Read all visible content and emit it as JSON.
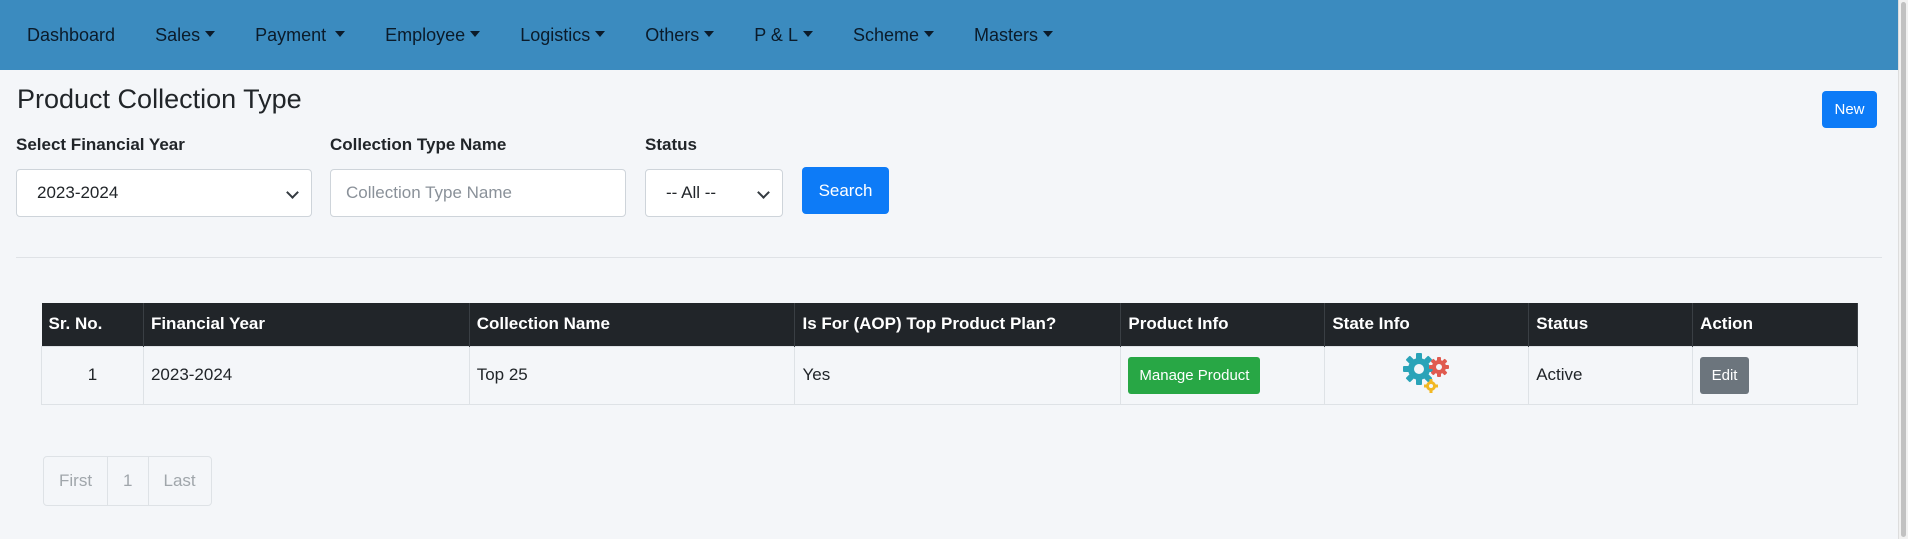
{
  "nav": {
    "items": [
      {
        "label": "Dashboard",
        "dropdown": false
      },
      {
        "label": "Sales",
        "dropdown": true
      },
      {
        "label": "Payment",
        "dropdown": true
      },
      {
        "label": "Employee",
        "dropdown": true
      },
      {
        "label": "Logistics",
        "dropdown": true
      },
      {
        "label": "Others",
        "dropdown": true
      },
      {
        "label": "P & L",
        "dropdown": true
      },
      {
        "label": "Scheme",
        "dropdown": true
      },
      {
        "label": "Masters",
        "dropdown": true
      }
    ],
    "background_color": "#3b8bbf"
  },
  "page": {
    "title": "Product Collection Type",
    "new_button": "New"
  },
  "filters": {
    "financial_year_label": "Select Financial Year",
    "financial_year_value": "2023-2024",
    "collection_name_label": "Collection Type Name",
    "collection_name_placeholder": "Collection Type Name",
    "status_label": "Status",
    "status_value": "-- All --",
    "search_button": "Search"
  },
  "table": {
    "headers": [
      "Sr. No.",
      "Financial Year",
      "Collection Name",
      "Is For (AOP) Top Product Plan?",
      "Product Info",
      "State Info",
      "Status",
      "Action"
    ],
    "rows": [
      {
        "sr_no": "1",
        "financial_year": "2023-2024",
        "collection_name": "Top 25",
        "aop_top_product_plan": "Yes",
        "product_info_button": "Manage Product",
        "state_info_icon": "gears-icon",
        "status": "Active",
        "action_button": "Edit"
      }
    ]
  },
  "pagination": {
    "first": "First",
    "page": "1",
    "last": "Last"
  },
  "colors": {
    "primary": "#0d7bf7",
    "success": "#28a745",
    "secondary": "#6c757d",
    "table_header": "#212529"
  }
}
